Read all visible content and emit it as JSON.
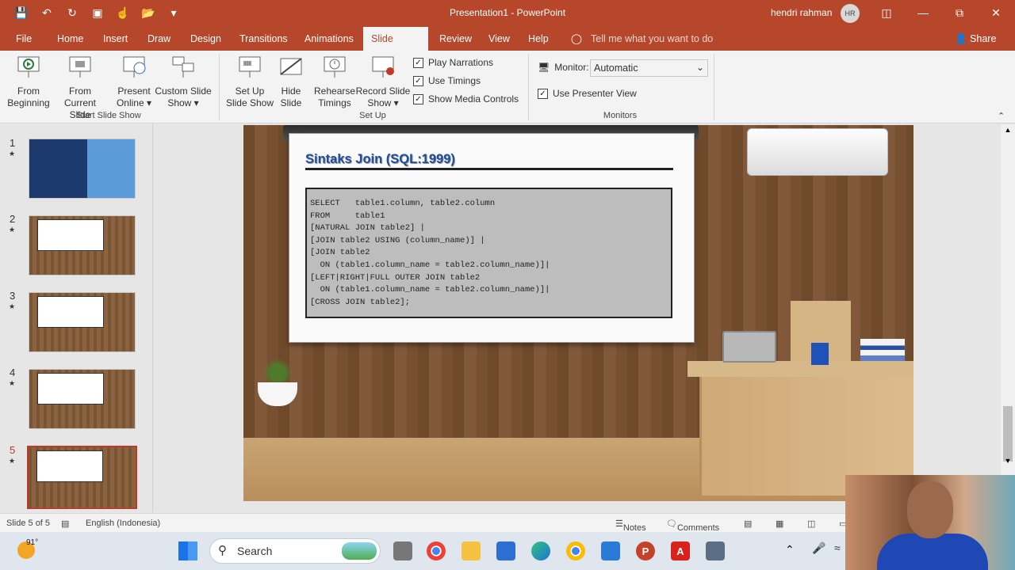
{
  "app": {
    "document_title": "Presentation1  -  PowerPoint",
    "user_name": "hendri rahman",
    "user_initials": "HR"
  },
  "tabs": [
    "File",
    "Home",
    "Insert",
    "Draw",
    "Design",
    "Transitions",
    "Animations",
    "Slide Show",
    "Review",
    "View",
    "Help"
  ],
  "active_tab": "Slide Show",
  "tell_me": "Tell me what you want to do",
  "share": "Share",
  "ribbon": {
    "from_beginning": [
      "From",
      "Beginning"
    ],
    "from_current": [
      "From",
      "Current Slide"
    ],
    "present_online": [
      "Present",
      "Online ▾"
    ],
    "custom_slide_show": [
      "Custom Slide",
      "Show ▾"
    ],
    "group_start": "Start Slide Show",
    "set_up_slide_show": [
      "Set Up",
      "Slide Show"
    ],
    "hide_slide": [
      "Hide",
      "Slide"
    ],
    "rehearse_timings": [
      "Rehearse",
      "Timings"
    ],
    "record_slide_show": [
      "Record Slide",
      "Show ▾"
    ],
    "play_narrations": "Play Narrations",
    "use_timings": "Use Timings",
    "show_media_controls": "Show Media Controls",
    "group_setup": "Set Up",
    "monitor_label": "Monitor:",
    "monitor_value": "Automatic",
    "use_presenter_view": "Use Presenter View",
    "group_monitors": "Monitors"
  },
  "thumbnails": [
    {
      "number": "1",
      "star": "★"
    },
    {
      "number": "2",
      "star": "★"
    },
    {
      "number": "3",
      "star": "★"
    },
    {
      "number": "4",
      "star": "★"
    },
    {
      "number": "5",
      "star": "★"
    }
  ],
  "slide": {
    "title": "Sintaks Join (SQL:1999)",
    "code_lines": [
      "SELECT   table1.column, table2.column",
      "FROM     table1",
      "[NATURAL JOIN table2] |",
      "[JOIN table2 USING (column_name)] |",
      "[JOIN table2",
      "  ON (table1.column_name = table2.column_name)]|",
      "[LEFT|RIGHT|FULL OUTER JOIN table2",
      "  ON (table1.column_name = table2.column_name)]|",
      "[CROSS JOIN table2];"
    ]
  },
  "status": {
    "slide_of": "Slide 5 of 5",
    "language": "English (Indonesia)",
    "notes": "Notes",
    "comments": "Comments"
  },
  "taskbar": {
    "weather_temp": "91°",
    "search_placeholder": "Search"
  }
}
